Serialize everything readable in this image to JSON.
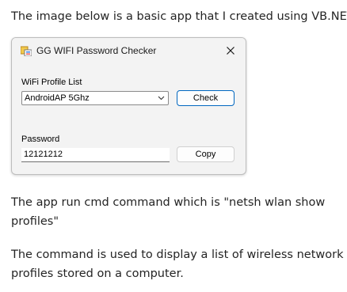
{
  "article": {
    "intro": "The image below is a basic app that I created using VB.NET",
    "para1": "The app run cmd command which is \"netsh wlan show profiles\"",
    "para2": "The command is used to display a list of wireless network profiles stored on a computer."
  },
  "window": {
    "title": "GG WIFI Password Checker",
    "close_glyph": "✕",
    "icon": "wifi-app-icon",
    "profile_label": "WiFi Profile List",
    "profile_selected": "AndroidAP 5Ghz",
    "check_label": "Check",
    "password_label": "Password",
    "password_value": "12121212",
    "copy_label": "Copy"
  },
  "colors": {
    "focus_border": "#0067c0",
    "window_bg": "#f3f3f3",
    "text": "#242424"
  }
}
